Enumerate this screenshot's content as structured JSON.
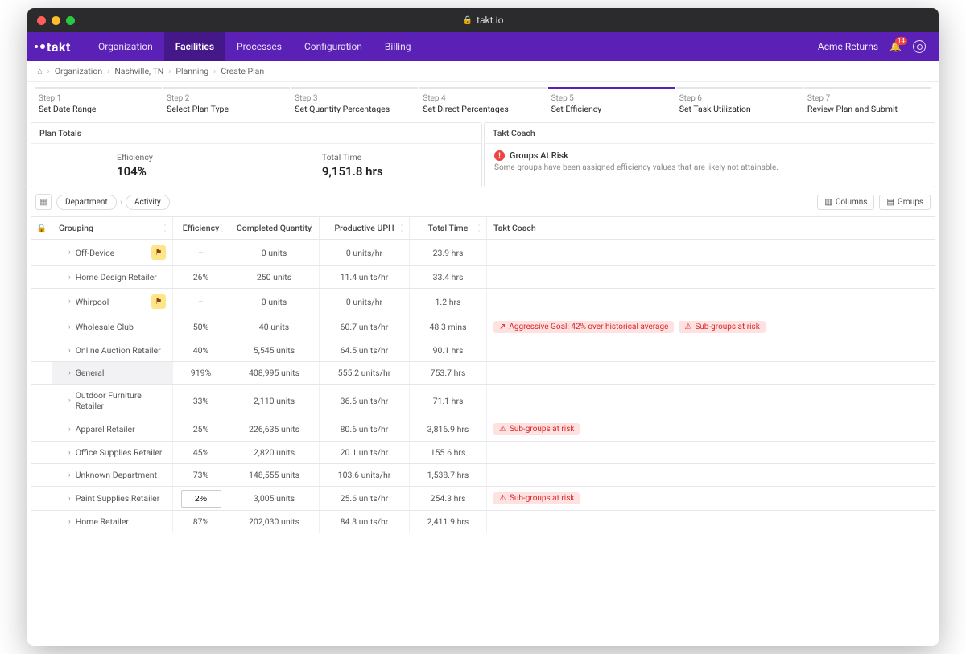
{
  "browser": {
    "url_host": "takt.io"
  },
  "brand": "takt",
  "nav": {
    "items": [
      "Organization",
      "Facilities",
      "Processes",
      "Configuration",
      "Billing"
    ],
    "active_index": 1
  },
  "header_right": {
    "account": "Acme Returns",
    "notifications_count": "14"
  },
  "breadcrumbs": [
    "Organization",
    "Nashville, TN",
    "Planning",
    "Create Plan"
  ],
  "stepper": {
    "active_index": 4,
    "steps": [
      {
        "num": "Step 1",
        "name": "Set Date Range"
      },
      {
        "num": "Step 2",
        "name": "Select Plan Type"
      },
      {
        "num": "Step 3",
        "name": "Set Quantity Percentages"
      },
      {
        "num": "Step 4",
        "name": "Set Direct Percentages"
      },
      {
        "num": "Step 5",
        "name": "Set Efficiency"
      },
      {
        "num": "Step 6",
        "name": "Set Task Utilization"
      },
      {
        "num": "Step 7",
        "name": "Review Plan and Submit"
      }
    ]
  },
  "totals": {
    "title": "Plan Totals",
    "efficiency_label": "Efficiency",
    "efficiency_value": "104%",
    "time_label": "Total Time",
    "time_value": "9,151.8 hrs"
  },
  "coach": {
    "title": "Takt Coach",
    "headline": "Groups At Risk",
    "note": "Some groups have been assigned efficiency values that are likely not attainable."
  },
  "group_toolbar": {
    "pill1": "Department",
    "pill2": "Activity",
    "btn_columns": "Columns",
    "btn_groups": "Groups"
  },
  "columns": {
    "grouping": "Grouping",
    "efficiency": "Efficiency",
    "completed_qty": "Completed Quantity",
    "prod_uph": "Productive UPH",
    "total_time": "Total Time",
    "takt_coach": "Takt Coach"
  },
  "rows": [
    {
      "name": "Off-Device",
      "eff": "–",
      "flag": true,
      "qty": "0 units",
      "uph": "0 units/hr",
      "time": "23.9 hrs",
      "badges": []
    },
    {
      "name": "Home Design Retailer",
      "eff": "26%",
      "qty": "250 units",
      "uph": "11.4 units/hr",
      "time": "33.4 hrs",
      "badges": []
    },
    {
      "name": "Whirpool",
      "eff": "–",
      "flag": true,
      "qty": "0 units",
      "uph": "0 units/hr",
      "time": "1.2 hrs",
      "badges": []
    },
    {
      "name": "Wholesale Club",
      "eff": "50%",
      "qty": "40 units",
      "uph": "60.7 units/hr",
      "time": "48.3 mins",
      "badges": [
        "aggressive",
        "subrisk"
      ]
    },
    {
      "name": "Online Auction Retailer",
      "eff": "40%",
      "qty": "5,545 units",
      "uph": "64.5 units/hr",
      "time": "90.1 hrs",
      "badges": []
    },
    {
      "name": "General",
      "eff": "919%",
      "selected": true,
      "qty": "408,995 units",
      "uph": "555.2 units/hr",
      "time": "753.7 hrs",
      "badges": []
    },
    {
      "name": "Outdoor Furniture Retailer",
      "eff": "33%",
      "qty": "2,110 units",
      "uph": "36.6 units/hr",
      "time": "71.1 hrs",
      "badges": []
    },
    {
      "name": "Apparel Retailer",
      "eff": "25%",
      "qty": "226,635 units",
      "uph": "80.6 units/hr",
      "time": "3,816.9 hrs",
      "badges": [
        "subrisk"
      ]
    },
    {
      "name": "Office Supplies Retailer",
      "eff": "45%",
      "qty": "2,820 units",
      "uph": "20.1 units/hr",
      "time": "155.6 hrs",
      "badges": []
    },
    {
      "name": "Unknown Department",
      "eff": "73%",
      "qty": "148,555 units",
      "uph": "103.6 units/hr",
      "time": "1,538.7 hrs",
      "badges": []
    },
    {
      "name": "Paint Supplies Retailer",
      "eff": "2%",
      "editing": true,
      "qty": "3,005 units",
      "uph": "25.6 units/hr",
      "time": "254.3 hrs",
      "badges": [
        "subrisk"
      ]
    },
    {
      "name": "Home Retailer",
      "eff": "87%",
      "qty": "202,030 units",
      "uph": "84.3 units/hr",
      "time": "2,411.9 hrs",
      "badges": []
    }
  ],
  "badge_labels": {
    "aggressive": "Aggressive Goal: 42% over historical average",
    "subrisk": "Sub-groups at risk"
  }
}
